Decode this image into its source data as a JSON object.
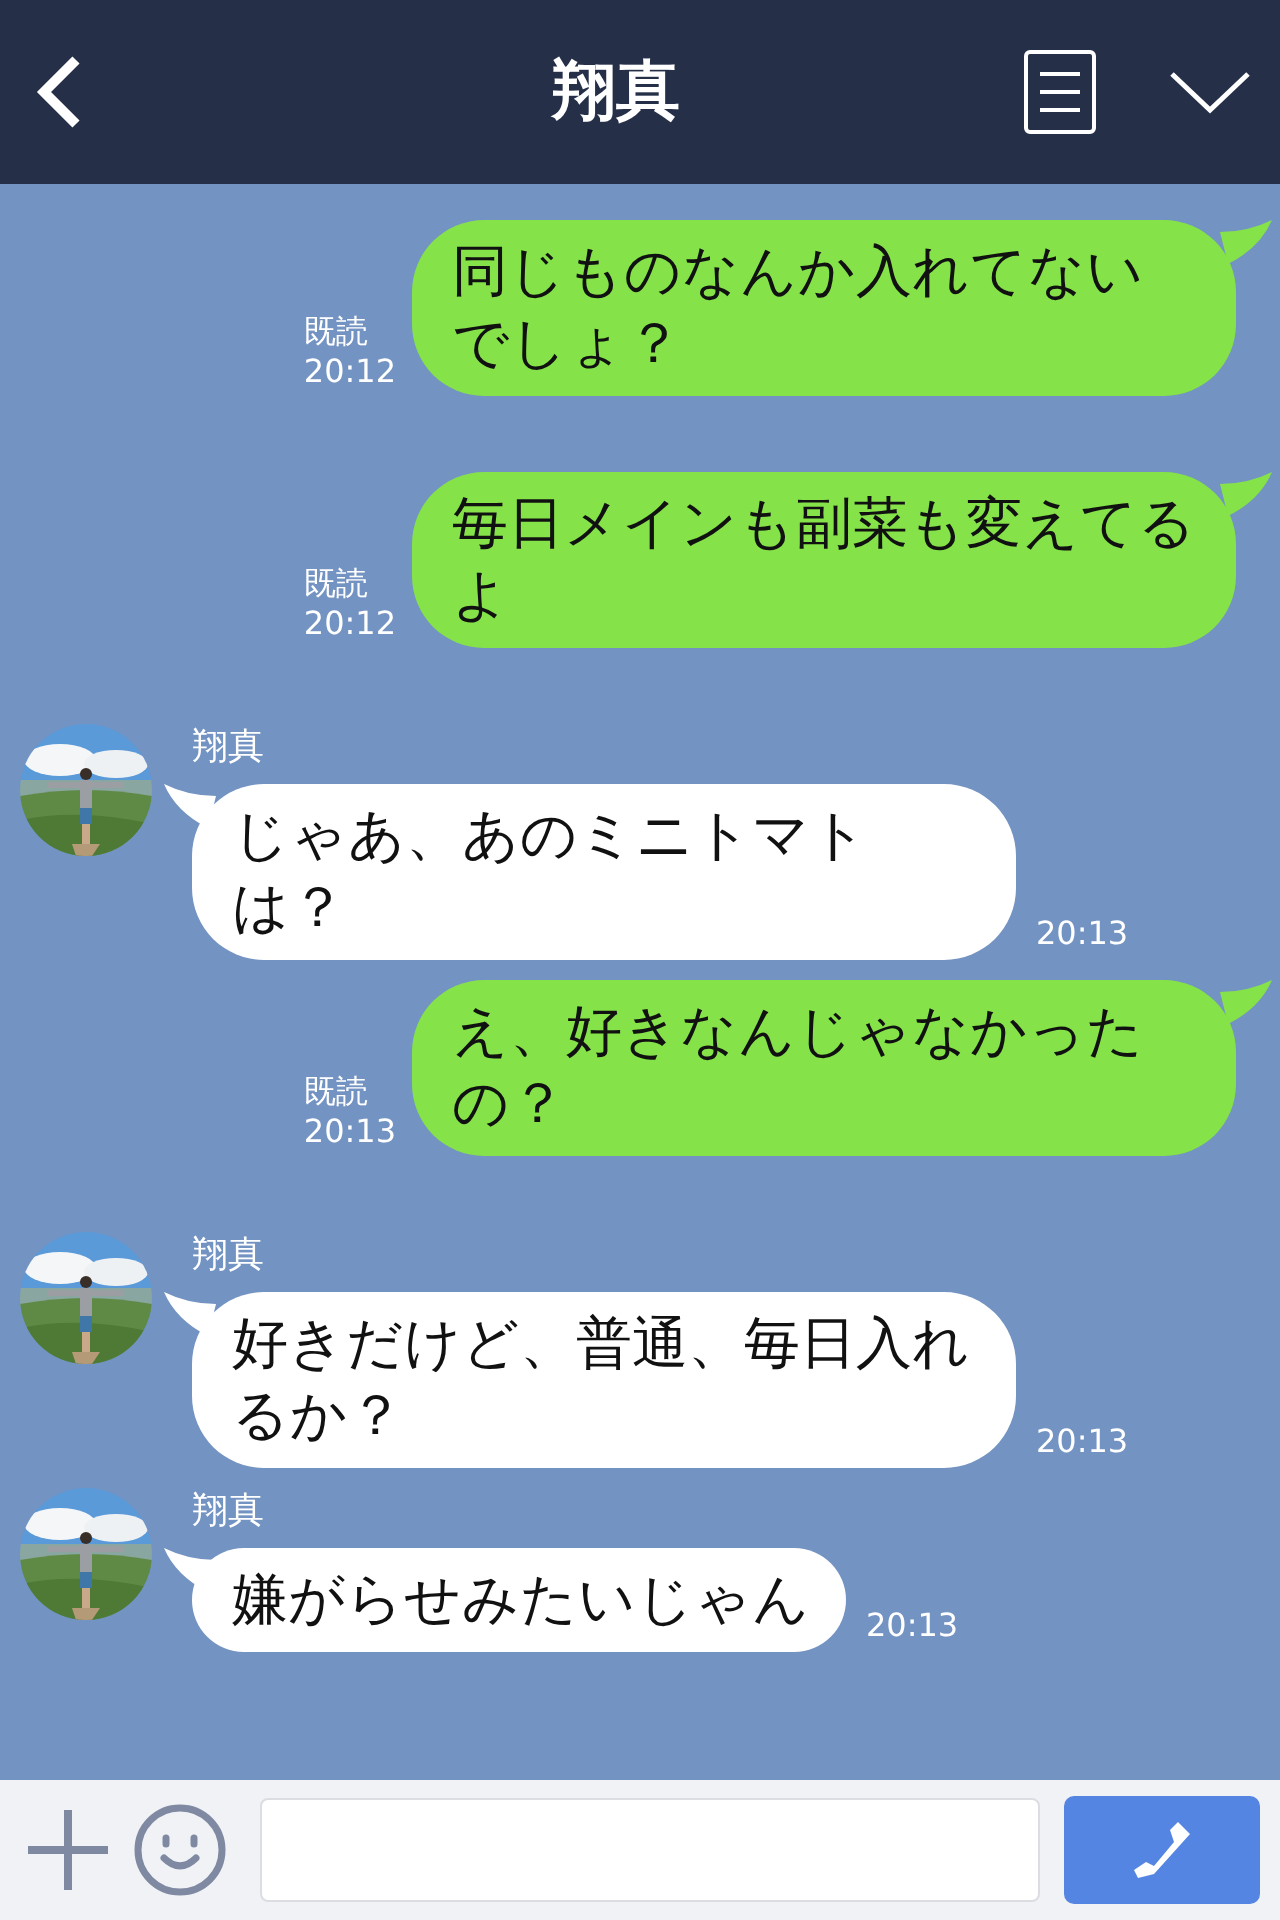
{
  "header": {
    "title": "翔真"
  },
  "messages": [
    {
      "kind": "sent",
      "text": "同じものなんか入れてないでしょ？",
      "read": "既読",
      "time": "20:12"
    },
    {
      "kind": "sent",
      "text": "毎日メインも副菜も変えてるよ",
      "read": "既読",
      "time": "20:12"
    },
    {
      "kind": "received",
      "name": "翔真",
      "text": "じゃあ、あのミニトマトは？",
      "time": "20:13"
    },
    {
      "kind": "sent",
      "text": "え、好きなんじゃなかったの？",
      "read": "既読",
      "time": "20:13"
    },
    {
      "kind": "received",
      "name": "翔真",
      "text": "好きだけど、普通、毎日入れるか？",
      "time": "20:13"
    },
    {
      "kind": "received",
      "name": "翔真",
      "text": "嫌がらせみたいじゃん",
      "time": "20:13"
    }
  ]
}
